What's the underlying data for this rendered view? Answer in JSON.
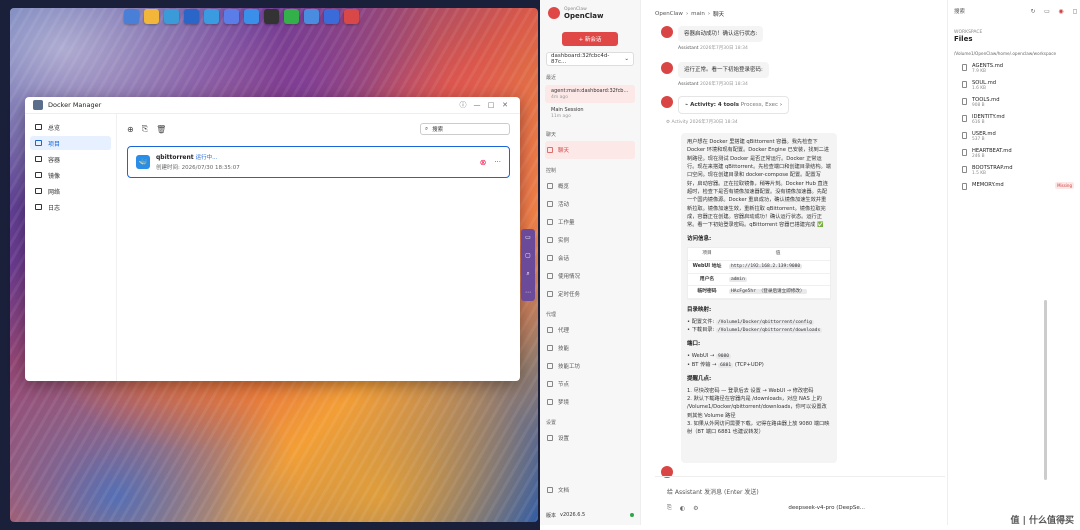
{
  "dock": {
    "icons": [
      "grid-icon",
      "folder-icon",
      "apps-icon",
      "speed-icon",
      "package-icon",
      "store-icon",
      "mail-icon",
      "terminal-icon",
      "app-icon",
      "headset-icon",
      "nas-icon",
      "openclaw-icon"
    ],
    "colors": [
      "#4a7fd8",
      "#f2b63a",
      "#3a9bd8",
      "#2a66c8",
      "#3a9be0",
      "#5a7de8",
      "#3a8fe8",
      "#333333",
      "#33b04a",
      "#4a8de0",
      "#3a6bd8",
      "#d84848"
    ]
  },
  "docker": {
    "title": "Docker Manager",
    "nav": [
      "总览",
      "项目",
      "容器",
      "镜像",
      "网络",
      "日志"
    ],
    "search": "搜索",
    "container": {
      "name": "qbittorrent",
      "status": "运行中...",
      "created": "创建时间: 2026/07/30 18:35:07"
    }
  },
  "sidebar": {
    "brand_sub": "OpenClaw",
    "brand": "OpenClaw",
    "new_chat": "+ 新会话",
    "session_select": "dashboard:32fcbc4d-87c...",
    "recent_label": "最近",
    "sessions": [
      {
        "title": "agent:main:dashboard:32fcb...",
        "time": "4m ago"
      },
      {
        "title": "Main Session",
        "time": "11m ago"
      }
    ],
    "chat_section": "聊天",
    "chat_item": "聊天",
    "control_label": "控制",
    "control": [
      "概览",
      "活动",
      "工作量",
      "实例",
      "会话",
      "使用情况",
      "定时任务"
    ],
    "agent_label": "代理",
    "agent": [
      "代理",
      "技能",
      "技能工坊",
      "节点",
      "梦境"
    ],
    "settings_label": "设置",
    "settings": [
      "设置"
    ],
    "docs": "文档",
    "version_label": "版本",
    "version": "v2026.6.5"
  },
  "chat": {
    "crumb_root": "OpenClaw",
    "crumb_mid": "main",
    "crumb_cur": "聊天",
    "m1": "容器启动成功！确认运行状态:",
    "assistant": "Assistant",
    "t1": "2026年7月30日 18:34",
    "m2": "运行正常。看一下初始登录密码:",
    "t2": "2026年7月30日 18:34",
    "activity_label": "Activity: 4 tools",
    "activity_sub": "Process, Exec",
    "activity_meta": "Activity",
    "t3": "2026年7月30日 18:34",
    "body": "用户想在 Docker 里搭建 qBittorrent 容器。我先检查下 Docker 环境和现有配置。Docker Engine 已安装，找到二进制路径。现在测试 Docker 是否正常运行。Docker 正常运行。现在来搭建 qBittorrent。先检查端口和创建目录结构。端口空闲。现在创建目录和 docker-compose 配置。配置写好，启动容器。正在拉取镜像，稍等片刻。Docker Hub 直连超时，检查下是否有镜像加速器配置。没有镜像加速器。先配一个国内镜像源。Docker 重启成功，确认镜像加速生效并重新拉取。镜像加速生效，重新拉取 qBittorrent。镜像拉取完成，容器正在创建。容器启动成功！确认运行状态。运行正常。看一下初始登录密码。qBittorrent 容器已搭建完成 ✅",
    "access_title": "访问信息:",
    "col_item": "项目",
    "col_val": "值",
    "rows": [
      {
        "k": "WebUI 地址",
        "v": "http://192.168.2.139:9080"
      },
      {
        "k": "用户名",
        "v": "admin"
      },
      {
        "k": "临时密码",
        "v": "HAcFge5hr （登录后请立即修改）"
      }
    ],
    "mount_title": "目录映射:",
    "mounts": [
      {
        "label": "配置文件:",
        "path": "/Volume1/Docker/qbittorrent/config"
      },
      {
        "label": "下载目录:",
        "path": "/Volume1/Docker/qbittorrent/downloads"
      }
    ],
    "port_title": "端口:",
    "ports": [
      {
        "label": "WebUI →",
        "val": "9080",
        "extra": ""
      },
      {
        "label": "BT 传输 →",
        "val": "6881",
        "extra": "(TCP+UDP)"
      }
    ],
    "tips_title": "提醒几点:",
    "tips": [
      "1. 尽快改密码 — 登录后去 设置 → WebUI → 修改密码",
      "2. 默认下载路径在容器内是 /downloads，对应 NAS 上的 /Volume1/Docker/qbittorrent/downloads，你可以设置改到其他 Volume 路径",
      "3. 如果从外网访问需要下载，记得在路由器上放 9080 端口映射（BT 端口 6881 也建议转发）"
    ],
    "placeholder": "给 Assistant 发消息 (Enter 发送)",
    "model": "deepseek-v4-pro (DeepSe..."
  },
  "files": {
    "search": "搜索",
    "ws_label": "WORKSPACE",
    "title": "Files",
    "path": "/Volume1/OpenClaw/home/.openclaw/workspace",
    "items": [
      {
        "n": "AGENTS.md",
        "s": "7.9 KB"
      },
      {
        "n": "SOUL.md",
        "s": "1.6 KB"
      },
      {
        "n": "TOOLS.md",
        "s": "908 B"
      },
      {
        "n": "IDENTITY.md",
        "s": "616 B"
      },
      {
        "n": "USER.md",
        "s": "537 B"
      },
      {
        "n": "HEARTBEAT.md",
        "s": "246 B"
      },
      {
        "n": "BOOTSTRAP.md",
        "s": "1.5 KB"
      },
      {
        "n": "MEMORY.md",
        "s": "",
        "missing": "Missing"
      }
    ]
  },
  "watermark": "值 | 什么值得买"
}
